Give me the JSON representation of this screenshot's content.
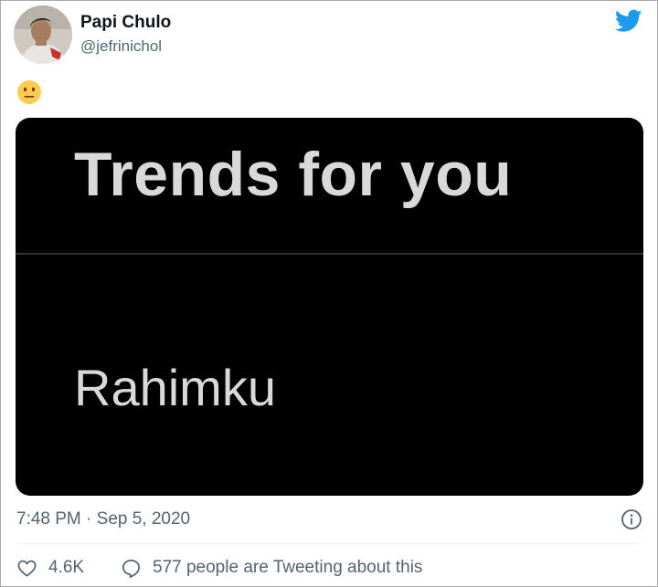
{
  "tweet": {
    "author": {
      "display_name": "Papi Chulo",
      "handle": "@jefrinichol"
    },
    "body_emoji": "neutral-face-emoji",
    "media": {
      "trend_title": "Trends for you",
      "trend_item": "Rahimku"
    },
    "timestamp": "7:48 PM · Sep 5, 2020",
    "like_count": "4.6K",
    "reply_text": "577 people are Tweeting about this"
  },
  "colors": {
    "twitter_blue": "#1d9bf0",
    "text_secondary": "#536471",
    "media_background": "#000000",
    "media_text": "#d9d9d9"
  }
}
